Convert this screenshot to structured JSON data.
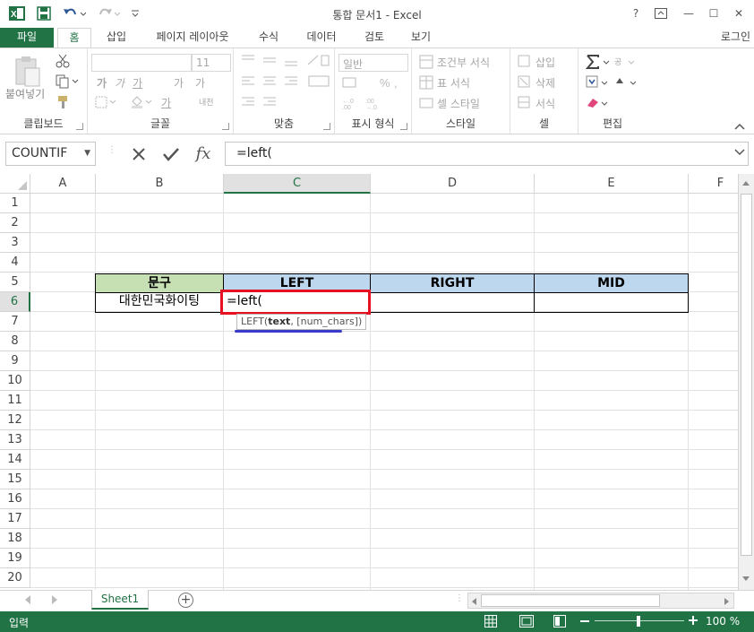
{
  "window": {
    "title": "통합 문서1 - Excel",
    "help": "?",
    "minimize": "—",
    "maximize": "☐",
    "close": "✕"
  },
  "tabs": {
    "file": "파일",
    "home": "홈",
    "insert": "삽입",
    "page_layout": "페이지 레이아웃",
    "formulas": "수식",
    "data": "데이터",
    "review": "검토",
    "view": "보기",
    "signin": "로그인"
  },
  "ribbon": {
    "clipboard": {
      "label": "클립보드",
      "paste": "붙여넣기"
    },
    "font": {
      "label": "글꼴",
      "size": "11",
      "bold": "가",
      "italic": "가",
      "underline": "가",
      "grow": "가",
      "shrink": "가",
      "phonetic": "내천"
    },
    "alignment": {
      "label": "맞춤"
    },
    "number": {
      "label": "표시 형식",
      "format": "일반"
    },
    "styles": {
      "label": "스타일",
      "conditional": "조건부 서식",
      "table": "표 서식",
      "cell": "셀 스타일"
    },
    "cells": {
      "label": "셀",
      "insert": "삽입",
      "delete": "삭제",
      "format": "서식"
    },
    "editing": {
      "label": "편집"
    }
  },
  "formula_bar": {
    "name_box": "COUNTIF",
    "formula": "=left(",
    "fx": "fx"
  },
  "grid": {
    "columns": [
      "A",
      "B",
      "C",
      "D",
      "E",
      "F"
    ],
    "rows": [
      "1",
      "2",
      "3",
      "4",
      "5",
      "6",
      "7",
      "8",
      "9",
      "10",
      "11",
      "12",
      "13",
      "14",
      "15",
      "16",
      "17",
      "18",
      "19",
      "20"
    ],
    "header_row": {
      "b": "문구",
      "c": "LEFT",
      "d": "RIGHT",
      "e": "MID"
    },
    "data_row": {
      "b": "대한민국화이팅",
      "c": "=left("
    },
    "tooltip": {
      "func": "LEFT(",
      "arg1": "text",
      "rest": ", [num_chars])"
    },
    "colors": {
      "b_header": "#c6e0b4",
      "cde_header": "#bdd7ee",
      "edit_border": "#e81123",
      "tooltip_underline": "#3a3ac8"
    }
  },
  "sheets": {
    "active": "Sheet1",
    "add": "+"
  },
  "status": {
    "mode": "입력",
    "zoom": "100 %"
  }
}
